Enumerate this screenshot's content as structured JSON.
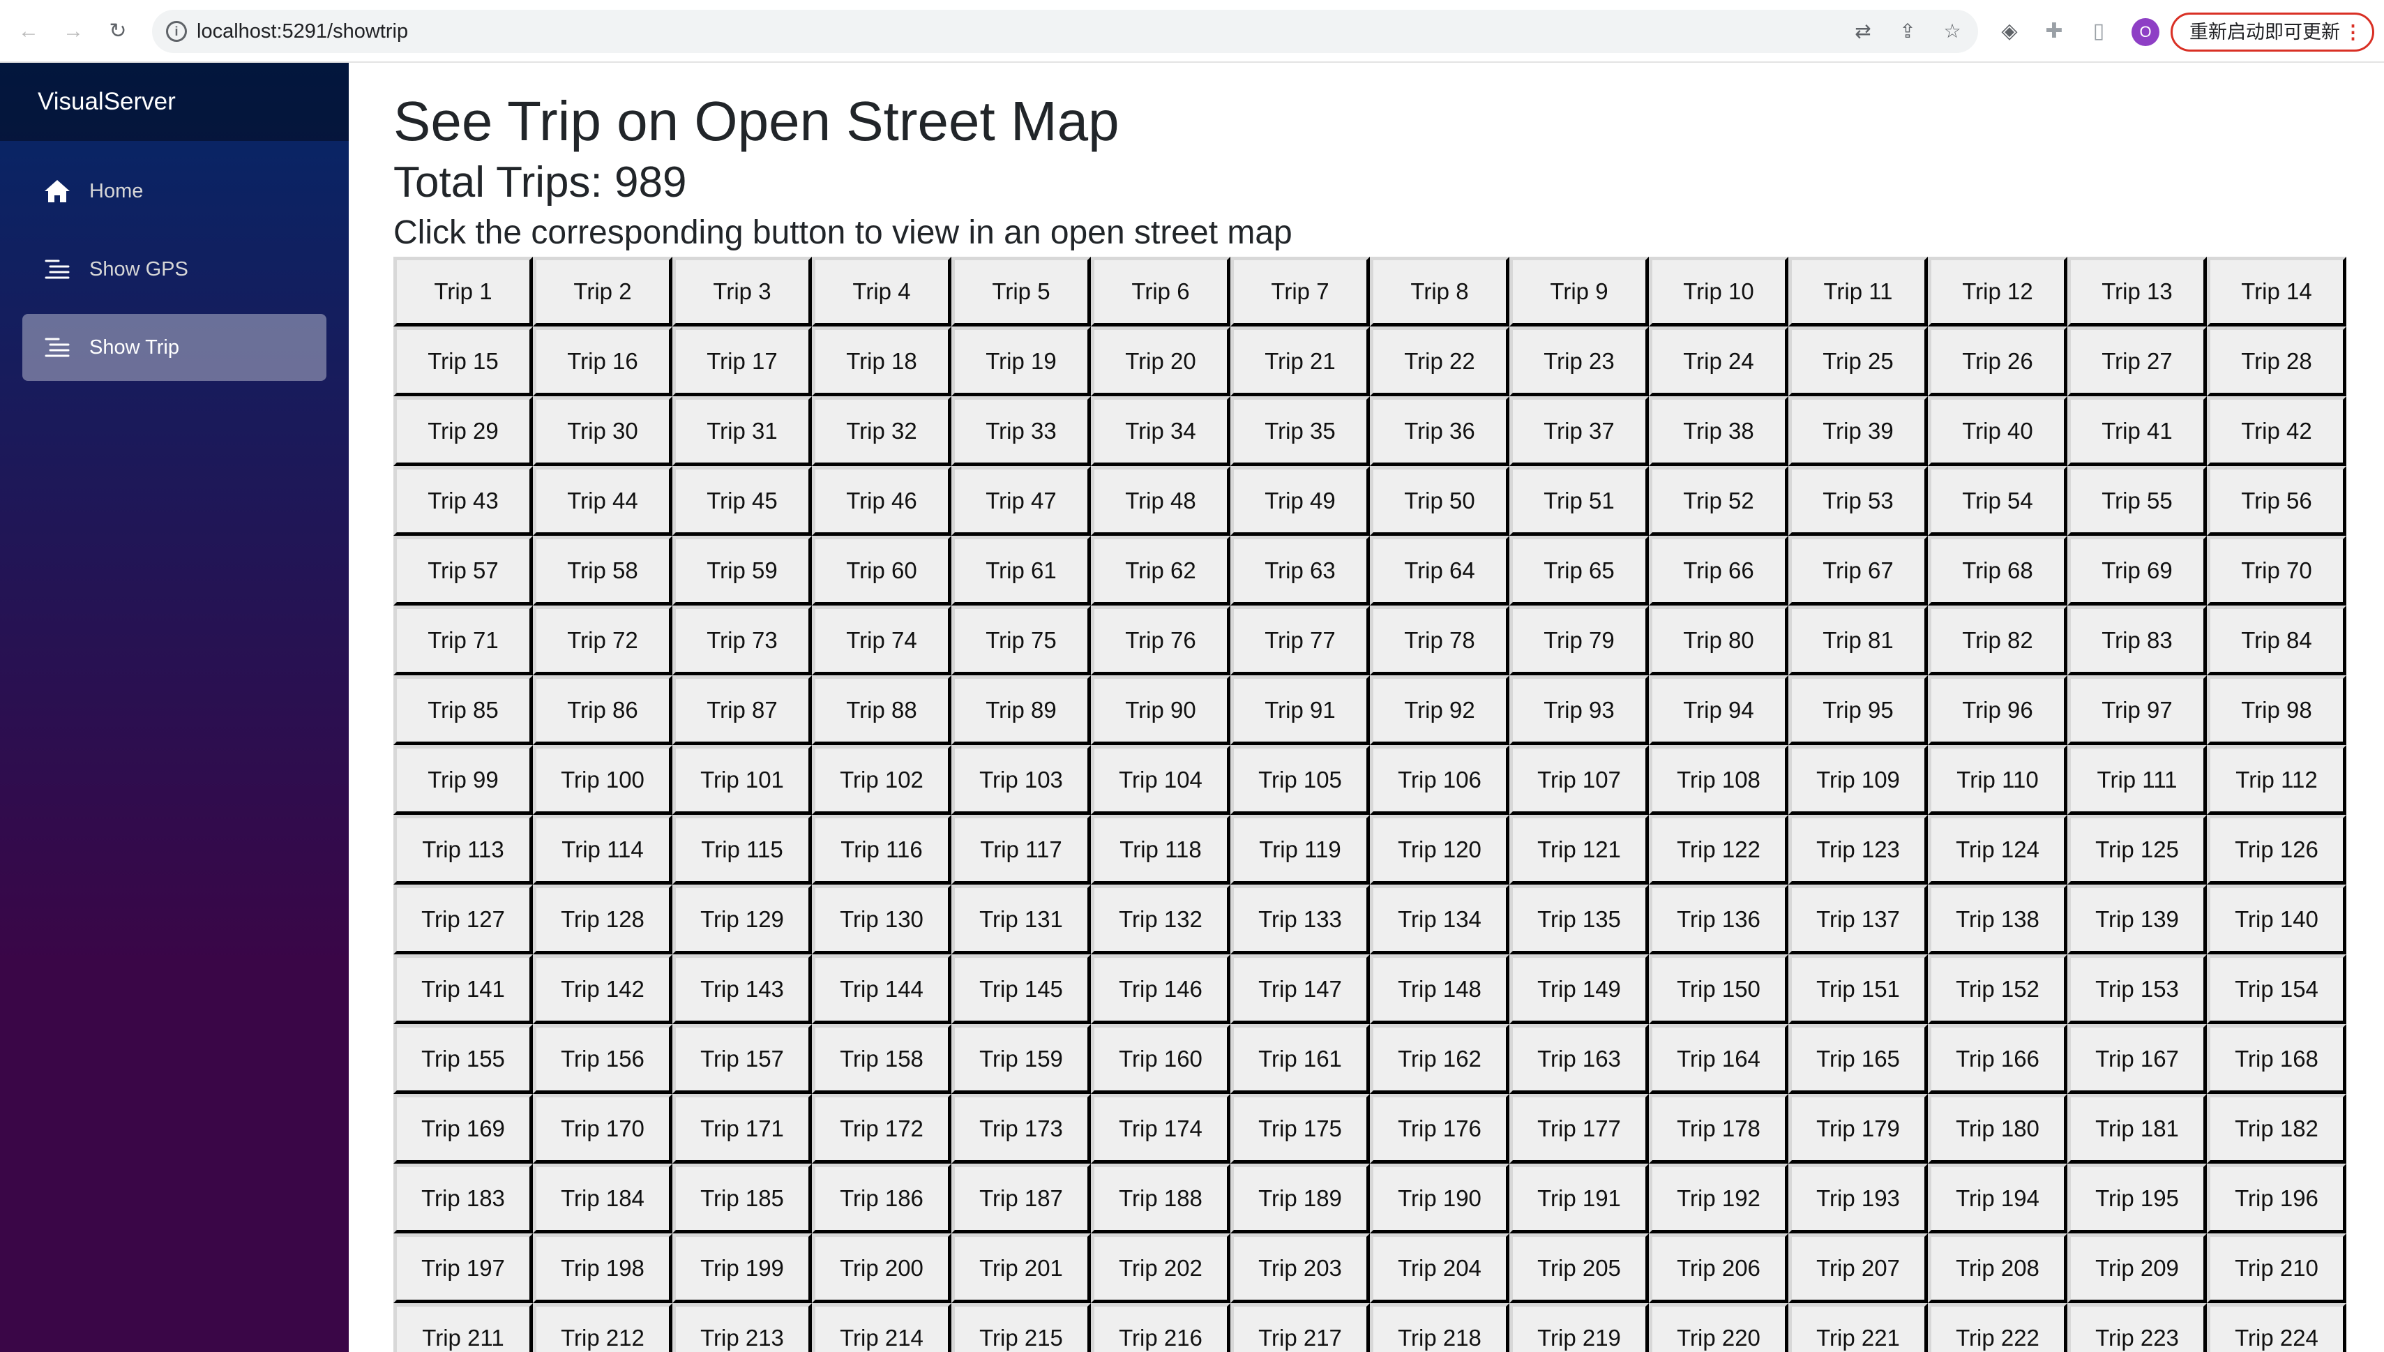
{
  "browser": {
    "url": "localhost:5291/showtrip",
    "profile_initial": "O",
    "update_label": "重新启动即可更新",
    "icons": [
      "back-icon",
      "forward-icon",
      "reload-icon",
      "info-icon",
      "translate-icon",
      "share-icon",
      "star-icon",
      "extension-icon",
      "puzzle-icon",
      "sidepanel-icon",
      "menu-icon"
    ]
  },
  "sidebar": {
    "brand": "VisualServer",
    "items": [
      {
        "label": "Home",
        "icon": "home-icon",
        "active": false
      },
      {
        "label": "Show GPS",
        "icon": "list-icon",
        "active": false
      },
      {
        "label": "Show Trip",
        "icon": "list-icon",
        "active": true
      }
    ]
  },
  "main": {
    "title": "See Trip on Open Street Map",
    "subtitle": "Total Trips: 989",
    "instruction": "Click the corresponding button to view in an open street map",
    "button_prefix": "Trip",
    "total_trips": 989
  },
  "colors": {
    "sidebar_top": "#052767",
    "sidebar_bottom": "#3a0647",
    "update_accent": "#d93025",
    "profile": "#8e3fc5"
  }
}
